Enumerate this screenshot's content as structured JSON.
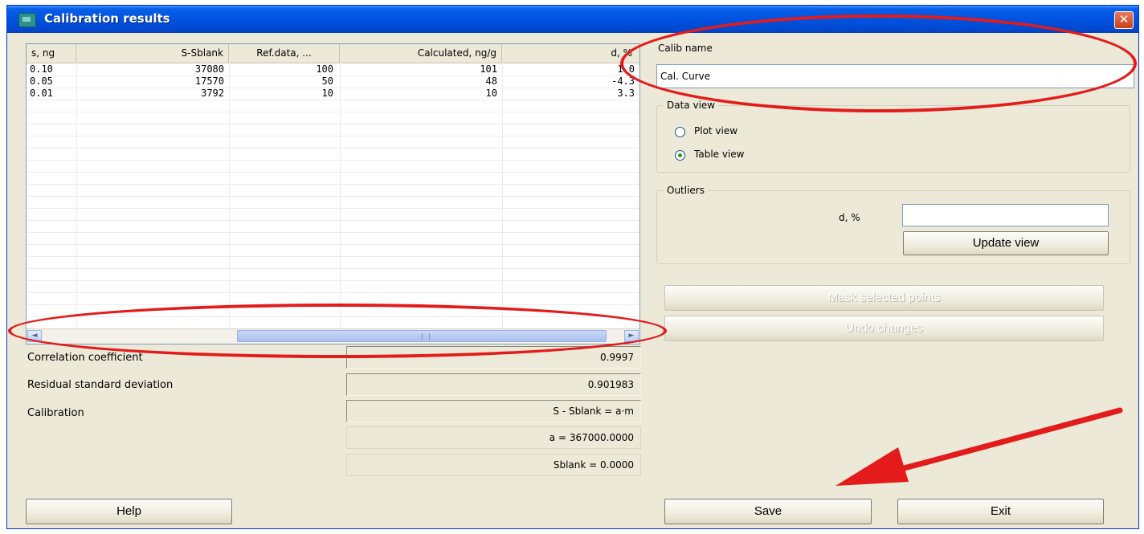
{
  "window": {
    "title": "Calibration results",
    "close_glyph": "✕"
  },
  "grid": {
    "columns": [
      "s, ng",
      "S-Sblank",
      "Ref.data, ...",
      "Calculated, ng/g",
      "d, %"
    ],
    "rows": [
      [
        "0.10",
        "37080",
        "100",
        "101",
        "1.0"
      ],
      [
        "0.05",
        "17570",
        "50",
        "48",
        "-4.3"
      ],
      [
        "0.01",
        "3792",
        "10",
        "10",
        "3.3"
      ]
    ],
    "scroll_left": "◄",
    "scroll_right": "►"
  },
  "stats": {
    "correlation_label": "Correlation coefficient",
    "correlation_value": "0.9997",
    "residual_label": "Residual standard deviation",
    "residual_value": "0.901983",
    "calibration_label": "Calibration",
    "formula": "S - Sblank = a·m",
    "a_value": "a = 367000.0000",
    "sblank_value": "Sblank = 0.0000"
  },
  "calib": {
    "label": "Calib name",
    "value": "Cal. Curve"
  },
  "data_view": {
    "title": "Data view",
    "options": [
      {
        "label": "Plot view",
        "checked": false
      },
      {
        "label": "Table view",
        "checked": true
      }
    ]
  },
  "outliers": {
    "title": "Outliers",
    "d_label": "d, %",
    "d_value": "",
    "update_label": "Update view"
  },
  "buttons": {
    "mask": "Mask selected points",
    "undo": "Undo changes",
    "help": "Help",
    "save": "Save",
    "exit": "Exit"
  },
  "colors": {
    "annotation": "#e31b1b",
    "titlebar": "#0054e3",
    "face": "#ece9d8"
  }
}
